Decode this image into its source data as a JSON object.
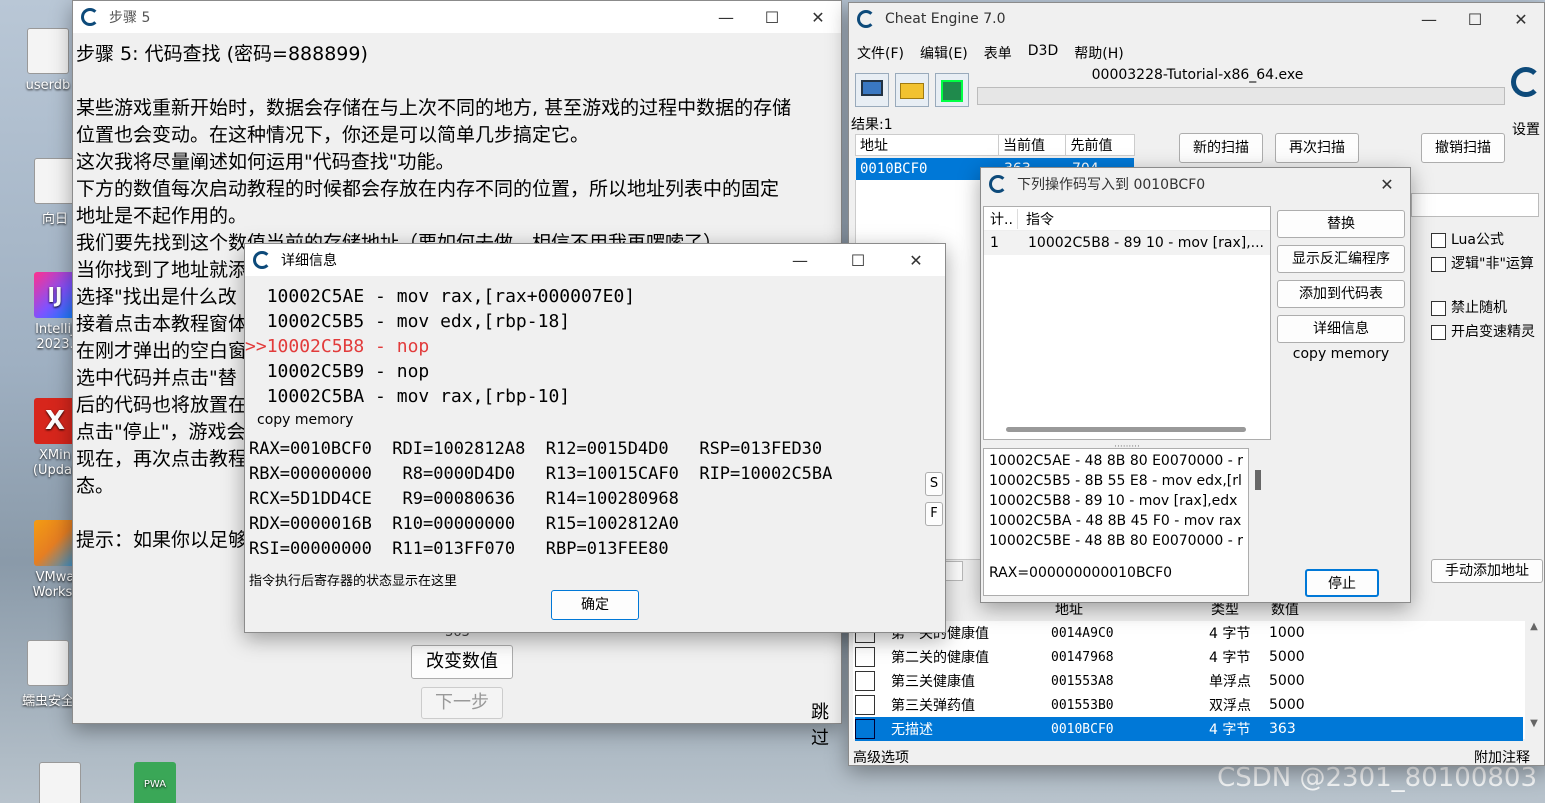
{
  "desktop": {
    "icons": [
      {
        "label": "userdb"
      },
      {
        "label": "向日"
      },
      {
        "label": "IntelliJ 2023."
      },
      {
        "label": "XMin (Updat"
      },
      {
        "label": "VMwa Workst"
      },
      {
        "label": "蠕虫安全"
      }
    ],
    "watermark": "CSDN @2301_80100803"
  },
  "tutorial": {
    "title": "步骤 5",
    "lines": [
      "步骤 5: 代码查找 (密码=888899)",
      "",
      "某些游戏重新开始时，数据会存储在与上次不同的地方, 甚至游戏的过程中数据的存储",
      "位置也会变动。在这种情况下，你还是可以简单几步搞定它。",
      "这次我将尽量阐述如何运用\"代码查找\"功能。",
      "下方的数值每次启动教程的时候都会存放在内存不同的位置，所以地址列表中的固定",
      "地址是不起作用的。",
      "我们要先找到这个数值当前的存储地址（要如何去做，相信不用我再啰嗦了）",
      "当你找到了地址就添",
      "选择\"找出是什么改",
      "接着点击本教程窗体",
      "在刚才弹出的空白窗",
      "选中代码并点击\"替",
      "后的代码也将放置在",
      "点击\"停止\"，游戏会",
      "现在，再次点击教程",
      "态。",
      "",
      "提示：如果你以足够"
    ],
    "value_partial": "363",
    "change_value_button": "改变数值",
    "next_button": "下一步",
    "skip_text": "跳过"
  },
  "details": {
    "title": "详细信息",
    "asm": [
      {
        "prefix": "  ",
        "text": "10002C5AE - mov rax,[rax+000007E0]",
        "highlight": false
      },
      {
        "prefix": "  ",
        "text": "10002C5B5 - mov edx,[rbp-18]",
        "highlight": false
      },
      {
        "prefix": ">>",
        "text": "10002C5B8 - nop",
        "highlight": true
      },
      {
        "prefix": "  ",
        "text": "10002C5B9 - nop",
        "highlight": false
      },
      {
        "prefix": "  ",
        "text": "10002C5BA - mov rax,[rbp-10]",
        "highlight": false
      }
    ],
    "copy_memory": "copy memory",
    "registers": [
      "RAX=0010BCF0  RDI=1002812A8  R12=0015D4D0   RSP=013FED30",
      "RBX=00000000   R8=0000D4D0   R13=10015CAF0  RIP=10002C5BA",
      "RCX=5D1DD4CE   R9=00080636   R14=100280968",
      "RDX=0000016B  R10=00000000   R15=1002812A0",
      "RSI=00000000  R11=013FF070   RBP=013FEE80"
    ],
    "side_buttons": [
      "S",
      "F"
    ],
    "status_text": "指令执行后寄存器的状态显示在这里",
    "ok_button": "确定"
  },
  "ce": {
    "title": "Cheat Engine 7.0",
    "menu": [
      "文件(F)",
      "编辑(E)",
      "表单",
      "D3D",
      "帮助(H)"
    ],
    "process": "00003228-Tutorial-x86_64.exe",
    "results": "结果:1",
    "settings": "设置",
    "scan_headers": [
      "地址",
      "当前值",
      "先前值"
    ],
    "scan_row": {
      "address": "0010BCF0",
      "current": "363",
      "previous": "704"
    },
    "new_scan": "新的扫描",
    "next_scan": "再次扫描",
    "undo_scan": "撤销扫描",
    "options": [
      "Lua公式",
      "逻辑\"非\"运算",
      "禁止随机",
      "开启变速精灵"
    ],
    "manual_add": "手动添加地址",
    "table_headers": [
      "地址",
      "类型",
      "数值"
    ],
    "table_rows": [
      {
        "desc": "第一关的健康值",
        "address": "0014A9C0",
        "type": "4 字节",
        "value": "1000",
        "selected": false
      },
      {
        "desc": "第二关的健康值",
        "address": "00147968",
        "type": "4 字节",
        "value": "5000",
        "selected": false
      },
      {
        "desc": "第三关健康值",
        "address": "001553A8",
        "type": "单浮点",
        "value": "5000",
        "selected": false
      },
      {
        "desc": "第三关弹药值",
        "address": "001553B0",
        "type": "双浮点",
        "value": "5000",
        "selected": false
      },
      {
        "desc": "无描述",
        "address": "0010BCF0",
        "type": "4 字节",
        "value": "363",
        "selected": true
      }
    ],
    "advanced": "高级选项",
    "attach_note": "附加注释"
  },
  "writes": {
    "title": "下列操作码写入到 0010BCF0",
    "headers": [
      "计..",
      "指令"
    ],
    "rows": [
      {
        "count": "1",
        "instr": "10002C5B8 - 89 10  - mov [rax],..."
      }
    ],
    "buttons": [
      "替换",
      "显示反汇编程序",
      "添加到代码表",
      "详细信息"
    ],
    "copy_memory": "copy memory",
    "disasm": [
      "10002C5AE - 48 8B 80 E0070000  - r",
      "10002C5B5 - 8B 55 E8  - mov edx,[rl",
      "10002C5B8 - 89 10  - mov [rax],edx",
      "10002C5BA - 48 8B 45 F0  - mov rax",
      "10002C5BE - 48 8B 80 E0070000  - r",
      "",
      "RAX=000000000010BCF0"
    ],
    "stop_button": "停止"
  },
  "colors": {
    "selection": "#0078d7",
    "highlight_red": "#e23b3b"
  }
}
